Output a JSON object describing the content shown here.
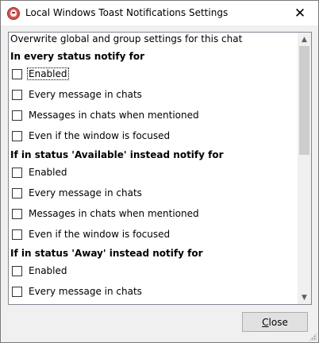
{
  "window": {
    "title": "Local Windows Toast Notifications Settings",
    "close_glyph": "✕"
  },
  "panel": {
    "intro": "Overwrite global and group settings for this chat",
    "sections": [
      {
        "header": "In every status notify for",
        "options": [
          {
            "label": "Enabled",
            "checked": false,
            "focused": true
          },
          {
            "label": "Every message in chats",
            "checked": false
          },
          {
            "label": "Messages in chats when mentioned",
            "checked": false
          },
          {
            "label": "Even if the window is focused",
            "checked": false
          }
        ]
      },
      {
        "header": "If in status 'Available' instead notify for",
        "options": [
          {
            "label": "Enabled",
            "checked": false
          },
          {
            "label": "Every message in chats",
            "checked": false
          },
          {
            "label": "Messages in chats when mentioned",
            "checked": false
          },
          {
            "label": "Even if the window is focused",
            "checked": false
          }
        ]
      },
      {
        "header": "If in status 'Away' instead notify for",
        "options": [
          {
            "label": "Enabled",
            "checked": false
          },
          {
            "label": "Every message in chats",
            "checked": false
          }
        ]
      }
    ],
    "scrollbar": {
      "up_glyph": "▲",
      "down_glyph": "▼"
    }
  },
  "footer": {
    "close_label_underlined": "C",
    "close_label_rest": "lose"
  }
}
